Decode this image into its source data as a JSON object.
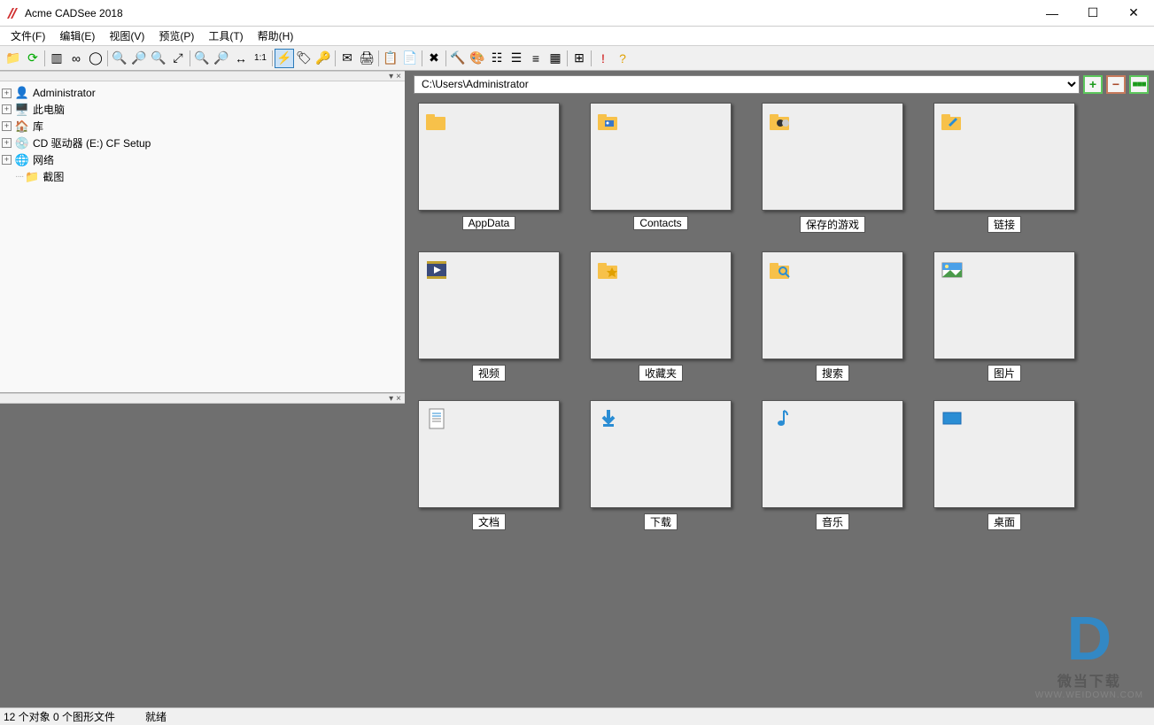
{
  "title": "Acme CADSee 2018",
  "menubar": [
    "文件(F)",
    "编辑(E)",
    "视图(V)",
    "预览(P)",
    "工具(T)",
    "帮助(H)"
  ],
  "tree": [
    {
      "icon": "👤",
      "label": "Administrator",
      "expand": "+",
      "color": "#5a8ab0"
    },
    {
      "icon": "🖥️",
      "label": "此电脑",
      "expand": "+",
      "color": "#3a78c8"
    },
    {
      "icon": "🏠",
      "label": "库",
      "expand": "+",
      "color": "#e0a030"
    },
    {
      "icon": "💿",
      "label": "CD 驱动器 (E:) CF Setup",
      "expand": "+",
      "color": "#777"
    },
    {
      "icon": "🌐",
      "label": "网络",
      "expand": "+",
      "color": "#3a78c8"
    },
    {
      "icon": "📁",
      "label": "截图",
      "expand": "",
      "indent": true,
      "color": "#f0c050"
    }
  ],
  "path": "C:\\Users\\Administrator",
  "folders": [
    {
      "name": "AppData",
      "icon": "folder"
    },
    {
      "name": "Contacts",
      "icon": "contacts"
    },
    {
      "name": "保存的游戏",
      "icon": "games"
    },
    {
      "name": "链接",
      "icon": "links"
    },
    {
      "name": "视频",
      "icon": "videos"
    },
    {
      "name": "收藏夹",
      "icon": "favorites"
    },
    {
      "name": "搜索",
      "icon": "search"
    },
    {
      "name": "图片",
      "icon": "pictures"
    },
    {
      "name": "文档",
      "icon": "documents"
    },
    {
      "name": "下载",
      "icon": "downloads"
    },
    {
      "name": "音乐",
      "icon": "music"
    },
    {
      "name": "桌面",
      "icon": "desktop"
    }
  ],
  "status": {
    "left": "12 个对象 0 个图形文件",
    "right": "就绪"
  },
  "watermark": {
    "big": "D",
    "line1": "微当下载",
    "line2": "WWW.WEIDOWN.COM"
  }
}
